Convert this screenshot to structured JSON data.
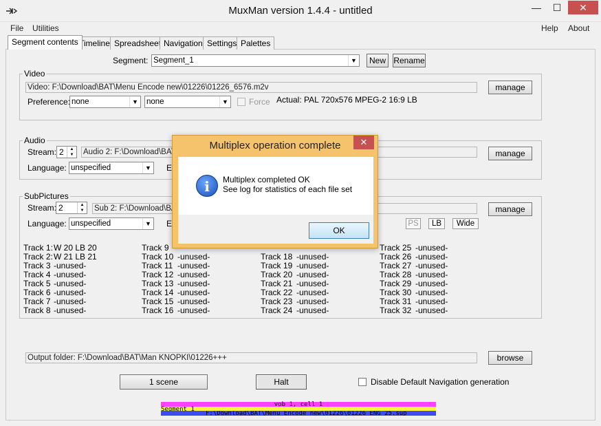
{
  "window": {
    "title": "MuxMan version 1.4.4 - untitled",
    "minimize_glyph": "—",
    "maximize_glyph": "☐",
    "close_glyph": "✕"
  },
  "menu": {
    "file": "File",
    "utilities": "Utilities",
    "help": "Help",
    "about": "About"
  },
  "tabs": [
    {
      "label": "Segment contents"
    },
    {
      "label": "Timeline"
    },
    {
      "label": "Spreadsheet"
    },
    {
      "label": "Navigation"
    },
    {
      "label": "Settings"
    },
    {
      "label": "Palettes"
    }
  ],
  "segment": {
    "label": "Segment:",
    "value": "Segment_1",
    "new_label": "New",
    "rename_label": "Rename"
  },
  "video": {
    "group_label": "Video",
    "path": "Video: F:\\Download\\BAT\\Menu Encode new\\01226\\01226_6576.m2v",
    "manage_label": "manage",
    "preference_label": "Preference:",
    "pref1": "none",
    "pref2": "none",
    "force_label": "Force",
    "actual": "Actual: PAL  720x576  MPEG-2  16:9 LB"
  },
  "audio": {
    "group_label": "Audio",
    "stream_label": "Stream:",
    "stream_value": "2",
    "path": "Audio 2: F:\\Download\\BAT",
    "manage_label": "manage",
    "language_label": "Language:",
    "language_value": "unspecified",
    "extra_label": "E"
  },
  "subpictures": {
    "group_label": "SubPictures",
    "stream_label": "Stream:",
    "stream_value": "2",
    "path": "Sub 2: F:\\Download\\BA",
    "manage_label": "manage",
    "language_label": "Language:",
    "language_value": "unspecified",
    "extra_label": "E",
    "ps_label": "PS",
    "lb_label": "LB",
    "wide_label": "Wide"
  },
  "tracks": {
    "col1": [
      [
        "Track 1:",
        "W 20  LB 20"
      ],
      [
        "Track 2:",
        "W 21  LB 21"
      ],
      [
        "Track 3",
        "-unused-"
      ],
      [
        "Track 4",
        "-unused-"
      ],
      [
        "Track 5",
        "-unused-"
      ],
      [
        "Track 6",
        "-unused-"
      ],
      [
        "Track 7",
        "-unused-"
      ],
      [
        "Track 8",
        "-unused-"
      ]
    ],
    "col2": [
      [
        "Track 9",
        ""
      ],
      [
        "Track 10",
        "-unused-"
      ],
      [
        "Track 11",
        "-unused-"
      ],
      [
        "Track 12",
        "-unused-"
      ],
      [
        "Track 13",
        "-unused-"
      ],
      [
        "Track 14",
        "-unused-"
      ],
      [
        "Track 15",
        "-unused-"
      ],
      [
        "Track 16",
        "-unused-"
      ]
    ],
    "col3": [
      [
        "",
        ""
      ],
      [
        "Track 18",
        "-unused-"
      ],
      [
        "Track 19",
        "-unused-"
      ],
      [
        "Track 20",
        "-unused-"
      ],
      [
        "Track 21",
        "-unused-"
      ],
      [
        "Track 22",
        "-unused-"
      ],
      [
        "Track 23",
        "-unused-"
      ],
      [
        "Track 24",
        "-unused-"
      ]
    ],
    "col4": [
      [
        "Track 25",
        "-unused-"
      ],
      [
        "Track 26",
        "-unused-"
      ],
      [
        "Track 27",
        "-unused-"
      ],
      [
        "Track 28",
        "-unused-"
      ],
      [
        "Track 29",
        "-unused-"
      ],
      [
        "Track 30",
        "-unused-"
      ],
      [
        "Track 31",
        "-unused-"
      ],
      [
        "Track 32",
        "-unused-"
      ]
    ]
  },
  "output": {
    "path": "Output folder: F:\\Download\\BAT\\Man KNOPKI\\01226+++",
    "browse_label": "browse"
  },
  "bottom": {
    "scene_label": "1 scene",
    "halt_label": "Halt",
    "disable_nav_label": "Disable Default Navigation generation"
  },
  "strip": {
    "line1": "vob 1, cell 1",
    "line2": "Segment_1",
    "line3": "F:\\Download\\BAT\\Menu Encode new\\01226\\01226_ENG_25.sup"
  },
  "dialog": {
    "title": "Multiplex operation complete",
    "close_glyph": "✕",
    "icon_glyph": "i",
    "line1": "Multiplex completed OK",
    "line2": "See log for statistics of each file set",
    "ok_label": "OK"
  },
  "colors": {
    "strip_magenta": "#ff40ff",
    "strip_yellow": "#f5f542",
    "strip_blue": "#3f4bf2",
    "dialog_frame": "#f4c36b",
    "close_red": "#c75050"
  }
}
